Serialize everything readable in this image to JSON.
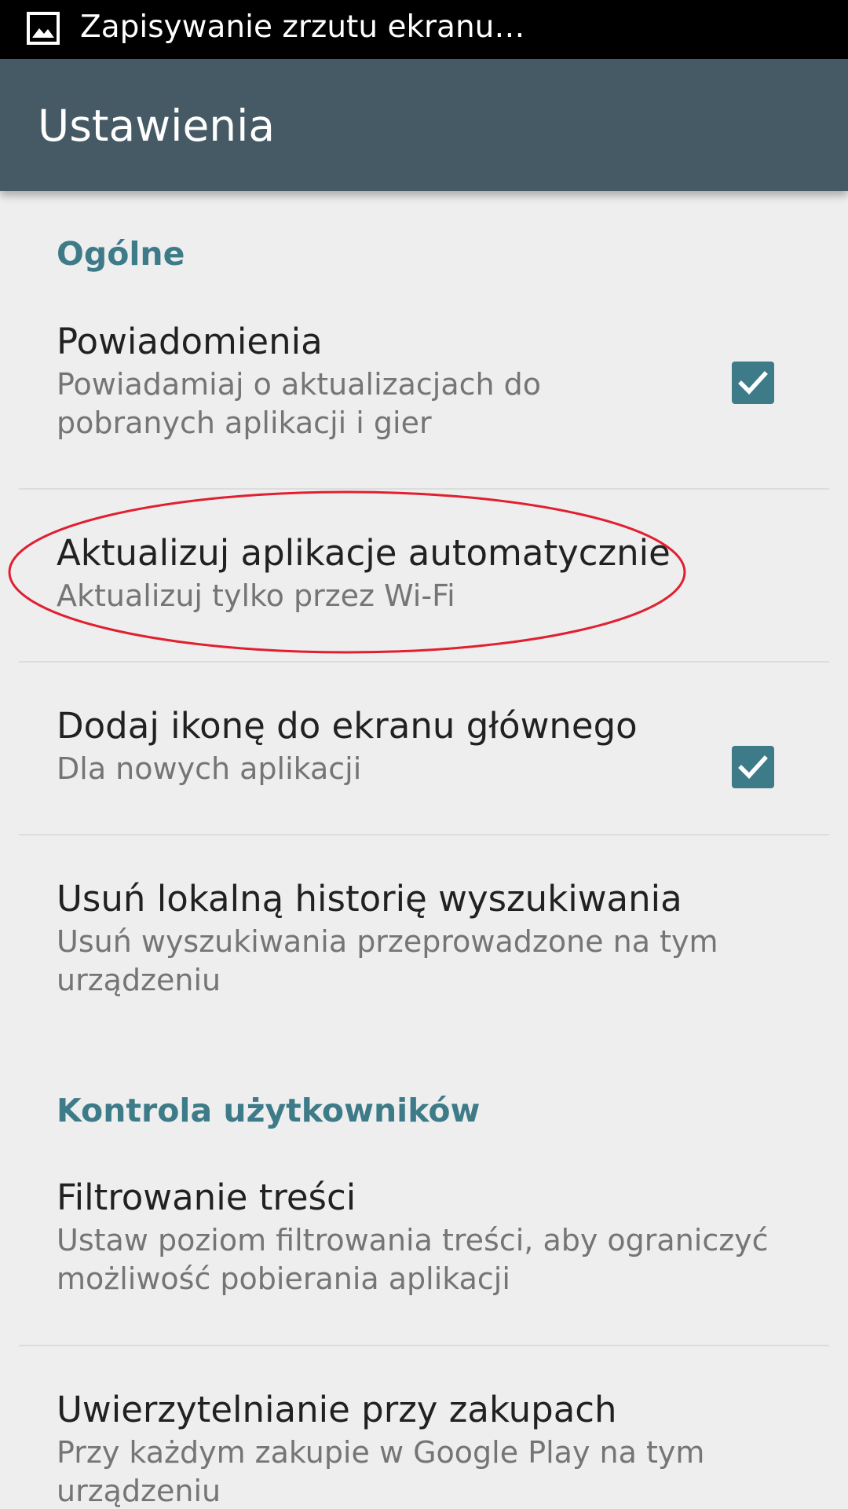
{
  "status_bar": {
    "notification_text": "Zapisywanie zrzutu ekranu…",
    "icon": "image-icon"
  },
  "app_bar": {
    "title": "Ustawienia",
    "color": "#455a64"
  },
  "theme": {
    "accent": "#3d7b88",
    "checkbox": "#3d7b88",
    "annotation": "#e02030"
  },
  "sections": [
    {
      "header": "Ogólne",
      "items": [
        {
          "title": "Powiadomienia",
          "summary": "Powiadamiaj o aktualizacjach do pobranych aplikacji i gier",
          "checked": true
        },
        {
          "title": "Aktualizuj aplikacje automatycznie",
          "summary": "Aktualizuj tylko przez Wi-Fi",
          "highlighted": true
        },
        {
          "title": "Dodaj ikonę do ekranu głównego",
          "summary": "Dla nowych aplikacji",
          "checked": true
        },
        {
          "title": "Usuń lokalną historię wyszukiwania",
          "summary": "Usuń wyszukiwania przeprowadzone na tym urządzeniu"
        }
      ]
    },
    {
      "header": "Kontrola użytkowników",
      "items": [
        {
          "title": "Filtrowanie treści",
          "summary": "Ustaw poziom filtrowania treści, aby ograniczyć możliwość pobierania aplikacji"
        },
        {
          "title": "Uwierzytelnianie przy zakupach",
          "summary": "Przy każdym zakupie w Google Play na tym urządzeniu"
        }
      ]
    }
  ]
}
